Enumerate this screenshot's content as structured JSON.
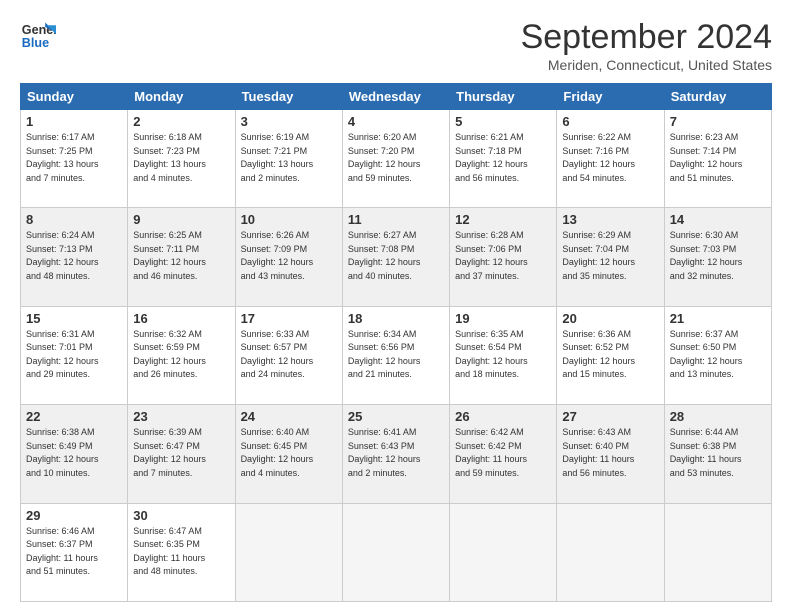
{
  "logo": {
    "line1": "General",
    "line2": "Blue"
  },
  "title": "September 2024",
  "location": "Meriden, Connecticut, United States",
  "weekdays": [
    "Sunday",
    "Monday",
    "Tuesday",
    "Wednesday",
    "Thursday",
    "Friday",
    "Saturday"
  ],
  "weeks": [
    [
      {
        "day": "1",
        "info": "Sunrise: 6:17 AM\nSunset: 7:25 PM\nDaylight: 13 hours\nand 7 minutes."
      },
      {
        "day": "2",
        "info": "Sunrise: 6:18 AM\nSunset: 7:23 PM\nDaylight: 13 hours\nand 4 minutes."
      },
      {
        "day": "3",
        "info": "Sunrise: 6:19 AM\nSunset: 7:21 PM\nDaylight: 13 hours\nand 2 minutes."
      },
      {
        "day": "4",
        "info": "Sunrise: 6:20 AM\nSunset: 7:20 PM\nDaylight: 12 hours\nand 59 minutes."
      },
      {
        "day": "5",
        "info": "Sunrise: 6:21 AM\nSunset: 7:18 PM\nDaylight: 12 hours\nand 56 minutes."
      },
      {
        "day": "6",
        "info": "Sunrise: 6:22 AM\nSunset: 7:16 PM\nDaylight: 12 hours\nand 54 minutes."
      },
      {
        "day": "7",
        "info": "Sunrise: 6:23 AM\nSunset: 7:14 PM\nDaylight: 12 hours\nand 51 minutes."
      }
    ],
    [
      {
        "day": "8",
        "info": "Sunrise: 6:24 AM\nSunset: 7:13 PM\nDaylight: 12 hours\nand 48 minutes."
      },
      {
        "day": "9",
        "info": "Sunrise: 6:25 AM\nSunset: 7:11 PM\nDaylight: 12 hours\nand 46 minutes."
      },
      {
        "day": "10",
        "info": "Sunrise: 6:26 AM\nSunset: 7:09 PM\nDaylight: 12 hours\nand 43 minutes."
      },
      {
        "day": "11",
        "info": "Sunrise: 6:27 AM\nSunset: 7:08 PM\nDaylight: 12 hours\nand 40 minutes."
      },
      {
        "day": "12",
        "info": "Sunrise: 6:28 AM\nSunset: 7:06 PM\nDaylight: 12 hours\nand 37 minutes."
      },
      {
        "day": "13",
        "info": "Sunrise: 6:29 AM\nSunset: 7:04 PM\nDaylight: 12 hours\nand 35 minutes."
      },
      {
        "day": "14",
        "info": "Sunrise: 6:30 AM\nSunset: 7:03 PM\nDaylight: 12 hours\nand 32 minutes."
      }
    ],
    [
      {
        "day": "15",
        "info": "Sunrise: 6:31 AM\nSunset: 7:01 PM\nDaylight: 12 hours\nand 29 minutes."
      },
      {
        "day": "16",
        "info": "Sunrise: 6:32 AM\nSunset: 6:59 PM\nDaylight: 12 hours\nand 26 minutes."
      },
      {
        "day": "17",
        "info": "Sunrise: 6:33 AM\nSunset: 6:57 PM\nDaylight: 12 hours\nand 24 minutes."
      },
      {
        "day": "18",
        "info": "Sunrise: 6:34 AM\nSunset: 6:56 PM\nDaylight: 12 hours\nand 21 minutes."
      },
      {
        "day": "19",
        "info": "Sunrise: 6:35 AM\nSunset: 6:54 PM\nDaylight: 12 hours\nand 18 minutes."
      },
      {
        "day": "20",
        "info": "Sunrise: 6:36 AM\nSunset: 6:52 PM\nDaylight: 12 hours\nand 15 minutes."
      },
      {
        "day": "21",
        "info": "Sunrise: 6:37 AM\nSunset: 6:50 PM\nDaylight: 12 hours\nand 13 minutes."
      }
    ],
    [
      {
        "day": "22",
        "info": "Sunrise: 6:38 AM\nSunset: 6:49 PM\nDaylight: 12 hours\nand 10 minutes."
      },
      {
        "day": "23",
        "info": "Sunrise: 6:39 AM\nSunset: 6:47 PM\nDaylight: 12 hours\nand 7 minutes."
      },
      {
        "day": "24",
        "info": "Sunrise: 6:40 AM\nSunset: 6:45 PM\nDaylight: 12 hours\nand 4 minutes."
      },
      {
        "day": "25",
        "info": "Sunrise: 6:41 AM\nSunset: 6:43 PM\nDaylight: 12 hours\nand 2 minutes."
      },
      {
        "day": "26",
        "info": "Sunrise: 6:42 AM\nSunset: 6:42 PM\nDaylight: 11 hours\nand 59 minutes."
      },
      {
        "day": "27",
        "info": "Sunrise: 6:43 AM\nSunset: 6:40 PM\nDaylight: 11 hours\nand 56 minutes."
      },
      {
        "day": "28",
        "info": "Sunrise: 6:44 AM\nSunset: 6:38 PM\nDaylight: 11 hours\nand 53 minutes."
      }
    ],
    [
      {
        "day": "29",
        "info": "Sunrise: 6:46 AM\nSunset: 6:37 PM\nDaylight: 11 hours\nand 51 minutes."
      },
      {
        "day": "30",
        "info": "Sunrise: 6:47 AM\nSunset: 6:35 PM\nDaylight: 11 hours\nand 48 minutes."
      },
      {
        "day": "",
        "info": ""
      },
      {
        "day": "",
        "info": ""
      },
      {
        "day": "",
        "info": ""
      },
      {
        "day": "",
        "info": ""
      },
      {
        "day": "",
        "info": ""
      }
    ]
  ]
}
